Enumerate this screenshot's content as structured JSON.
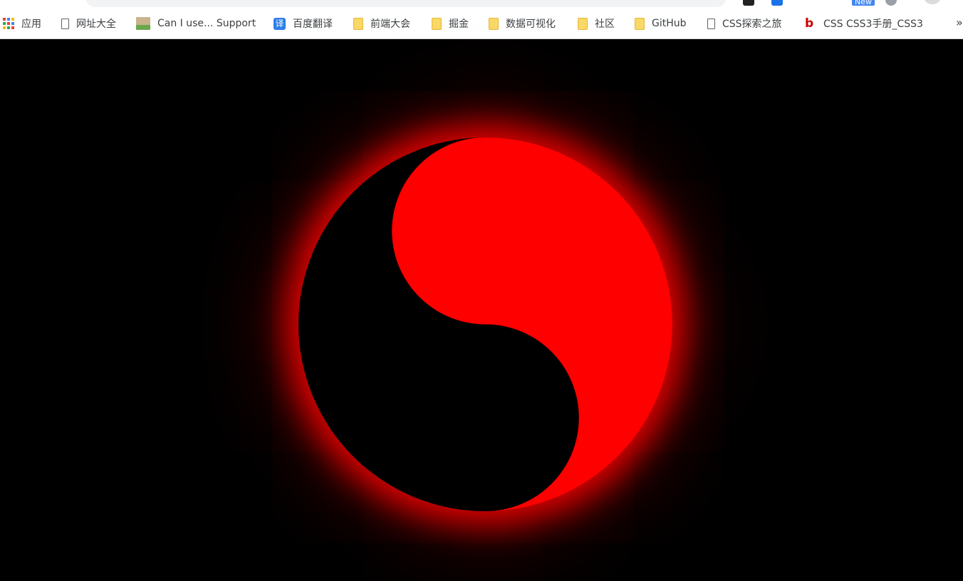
{
  "browser": {
    "bookmarks": [
      {
        "label": "应用",
        "icon": "apps-grid-icon"
      },
      {
        "label": "网址大全",
        "icon": "page-icon"
      },
      {
        "label": "Can I use... Support",
        "icon": "caniuse-icon"
      },
      {
        "label": "百度翻译",
        "icon": "translate-icon",
        "icon_text": "译"
      },
      {
        "label": "前端大会",
        "icon": "folder-icon"
      },
      {
        "label": "掘金",
        "icon": "folder-icon"
      },
      {
        "label": "数据可视化",
        "icon": "folder-icon"
      },
      {
        "label": "社区",
        "icon": "folder-icon"
      },
      {
        "label": "GitHub",
        "icon": "folder-icon"
      },
      {
        "label": "CSS探索之旅",
        "icon": "page-icon"
      },
      {
        "label": "CSS CSS3手册_CSS3",
        "icon": "b-logo-icon"
      }
    ],
    "more_label": "»",
    "new_badge": "New"
  },
  "colors": {
    "background": "#000000",
    "yin": "#000000",
    "yang": "#ff0000",
    "glow": "#ff0000",
    "bookmark_bar": "#ffffff",
    "new_badge": "#4285f4"
  }
}
